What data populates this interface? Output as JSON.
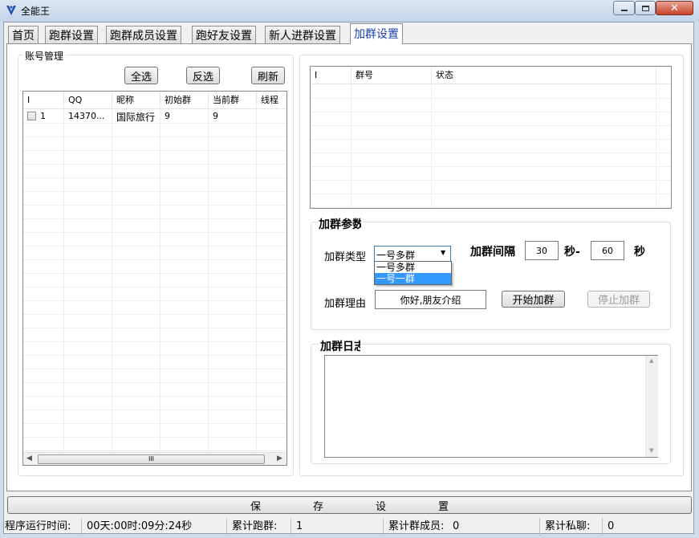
{
  "window": {
    "title": "全能王"
  },
  "tabs": [
    {
      "label": "首页"
    },
    {
      "label": "跑群设置"
    },
    {
      "label": "跑群成员设置"
    },
    {
      "label": "跑好友设置"
    },
    {
      "label": "新人进群设置"
    },
    {
      "label": "加群设置"
    }
  ],
  "accounts": {
    "group_label": "账号管理",
    "select_all": "全选",
    "invert": "反选",
    "refresh": "刷新",
    "columns": [
      "I",
      "QQ",
      "昵称",
      "初始群",
      "当前群",
      "线程"
    ],
    "rows": [
      {
        "index": "1",
        "qq": "14370...",
        "nickname": "国际旅行",
        "initial": "9",
        "current": "9",
        "thread": ""
      }
    ],
    "scroll_thumb": "III"
  },
  "groups_list": {
    "columns": [
      "I",
      "群号",
      "状态"
    ]
  },
  "params": {
    "group_label": "加群参数",
    "type_label": "加群类型",
    "type_selected": "一号多群",
    "type_options": [
      "一号多群",
      "一号一群"
    ],
    "interval_label": "加群间隔",
    "interval_min": "30",
    "sec_dash": "秒-",
    "interval_max": "60",
    "sec": "秒",
    "reason_label": "加群理由",
    "reason_value": "你好,朋友介绍",
    "start": "开始加群",
    "stop": "停止加群"
  },
  "log": {
    "group_label": "加群日志"
  },
  "save_button": "保　　　　　存　　　　　设　　　　　置",
  "status": {
    "runtime_label": "程序运行时间:",
    "runtime_value": "00天:00时:09分:24秒",
    "runs_label": "累计跑群:",
    "runs_value": "1",
    "members_label": "累计群成员:",
    "members_value": "0",
    "private_label": "累计私聊:",
    "private_value": "0"
  }
}
